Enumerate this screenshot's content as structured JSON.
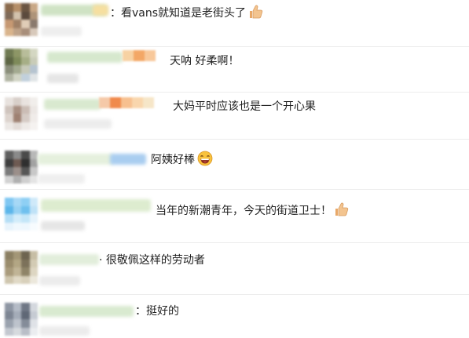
{
  "comments": [
    {
      "text": "：看vans就知道是老街头了"
    },
    {
      "text": "天呐 好柔啊！"
    },
    {
      "text": "大妈平时应该也是一个开心果"
    },
    {
      "text": "阿姨好棒"
    },
    {
      "text": "当年的新潮青年，今天的街道卫士！"
    },
    {
      "text": "·  很敬佩这样的劳动者"
    },
    {
      "text": "：挺好的"
    }
  ],
  "colors": {
    "divider": "#ececec",
    "text": "#222222",
    "blurred_name_green": "#cfe3c4",
    "blurred_name_orange": "#f3a766"
  },
  "icons": [
    "thumbs-up-icon",
    "laughing-emoji-icon"
  ]
}
